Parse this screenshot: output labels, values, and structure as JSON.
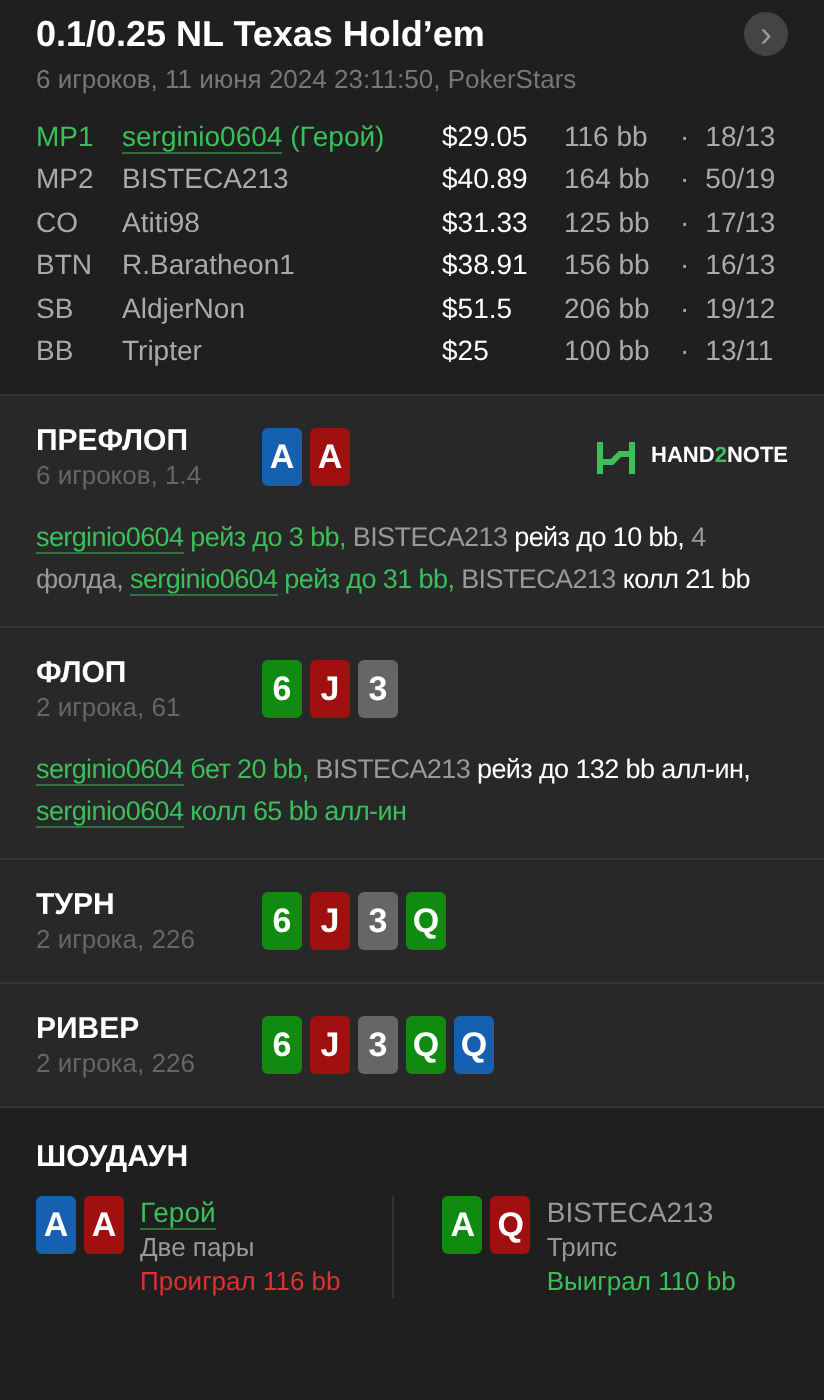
{
  "header": {
    "title": "0.1/0.25 NL Texas Hold’em",
    "subtitle": "6 игроков, 11 июня 2024 23:11:50, PokerStars",
    "next_button": "›"
  },
  "players": [
    {
      "position": "MP1",
      "name": "serginio0604",
      "hero": true,
      "hero_tag": "(Герой)",
      "stack": "$29.05",
      "bb": "116 bb",
      "sep": "·",
      "stats": "18/13"
    },
    {
      "position": "MP2",
      "name": "BISTECA213",
      "hero": false,
      "stack": "$40.89",
      "bb": "164 bb",
      "sep": "·",
      "stats": "50/19"
    },
    {
      "position": "CO",
      "name": "Atiti98",
      "hero": false,
      "stack": "$31.33",
      "bb": "125 bb",
      "sep": "·",
      "stats": "17/13"
    },
    {
      "position": "BTN",
      "name": "R.Baratheon1",
      "hero": false,
      "stack": "$38.91",
      "bb": "156 bb",
      "sep": "·",
      "stats": "16/13"
    },
    {
      "position": "SB",
      "name": "AldjerNon",
      "hero": false,
      "stack": "$51.5",
      "bb": "206 bb",
      "sep": "·",
      "stats": "19/12"
    },
    {
      "position": "BB",
      "name": "Tripter",
      "hero": false,
      "stack": "$25",
      "bb": "100 bb",
      "sep": "·",
      "stats": "13/11"
    }
  ],
  "streets": [
    {
      "name": "ПРЕФЛОП",
      "info": "6 игроков, 1.4",
      "cards": [
        {
          "rank": "A",
          "color": "#1560b0"
        },
        {
          "rank": "A",
          "color": "#a01010"
        }
      ],
      "logo": {
        "before": "HAND",
        "highlight": "2",
        "after": "NOTE"
      },
      "actions": [
        {
          "kind": "hero",
          "text": "serginio0604"
        },
        {
          "kind": "hero_action",
          "text": "рейз до 3 bb,"
        },
        {
          "kind": "player",
          "text": "BISTECA213"
        },
        {
          "kind": "action",
          "text": "рейз до 10 bb,"
        },
        {
          "kind": "muted",
          "text": "4 фолда,"
        },
        {
          "kind": "hero",
          "text": "serginio0604"
        },
        {
          "kind": "hero_action",
          "text": "рейз до 31 bb,"
        },
        {
          "kind": "player",
          "text": "BISTECA213"
        },
        {
          "kind": "action",
          "text": "колл 21 bb"
        }
      ]
    },
    {
      "name": "ФЛОП",
      "info": "2 игрока, 61",
      "cards": [
        {
          "rank": "6",
          "color": "#108a10"
        },
        {
          "rank": "J",
          "color": "#a01010"
        },
        {
          "rank": "3",
          "color": "#666666"
        }
      ],
      "actions": [
        {
          "kind": "hero",
          "text": "serginio0604"
        },
        {
          "kind": "hero_action",
          "text": "бет 20 bb,"
        },
        {
          "kind": "player",
          "text": "BISTECA213"
        },
        {
          "kind": "action",
          "text": "рейз до 132 bb алл-ин,"
        },
        {
          "kind": "hero",
          "text": "serginio0604"
        },
        {
          "kind": "hero_action",
          "text": "колл 65 bb алл-ин"
        }
      ]
    },
    {
      "name": "ТУРН",
      "info": "2 игрока, 226",
      "cards": [
        {
          "rank": "6",
          "color": "#108a10"
        },
        {
          "rank": "J",
          "color": "#a01010"
        },
        {
          "rank": "3",
          "color": "#666666"
        },
        {
          "rank": "Q",
          "color": "#108a10"
        }
      ]
    },
    {
      "name": "РИВЕР",
      "info": "2 игрока, 226",
      "cards": [
        {
          "rank": "6",
          "color": "#108a10"
        },
        {
          "rank": "J",
          "color": "#a01010"
        },
        {
          "rank": "3",
          "color": "#666666"
        },
        {
          "rank": "Q",
          "color": "#108a10"
        },
        {
          "rank": "Q",
          "color": "#1560b0"
        }
      ]
    }
  ],
  "showdown": {
    "title": "ШОУДАУН",
    "hands": [
      {
        "cards": [
          {
            "rank": "A",
            "color": "#1560b0"
          },
          {
            "rank": "A",
            "color": "#a01010"
          }
        ],
        "name": "Герой",
        "hero": true,
        "hand": "Две пары",
        "result": "Проиграл 116 bb",
        "won": false
      },
      {
        "cards": [
          {
            "rank": "A",
            "color": "#108a10"
          },
          {
            "rank": "Q",
            "color": "#a01010"
          }
        ],
        "name": "BISTECA213",
        "hero": false,
        "hand": "Трипс",
        "result": "Выиграл 110 bb",
        "won": true
      }
    ]
  }
}
